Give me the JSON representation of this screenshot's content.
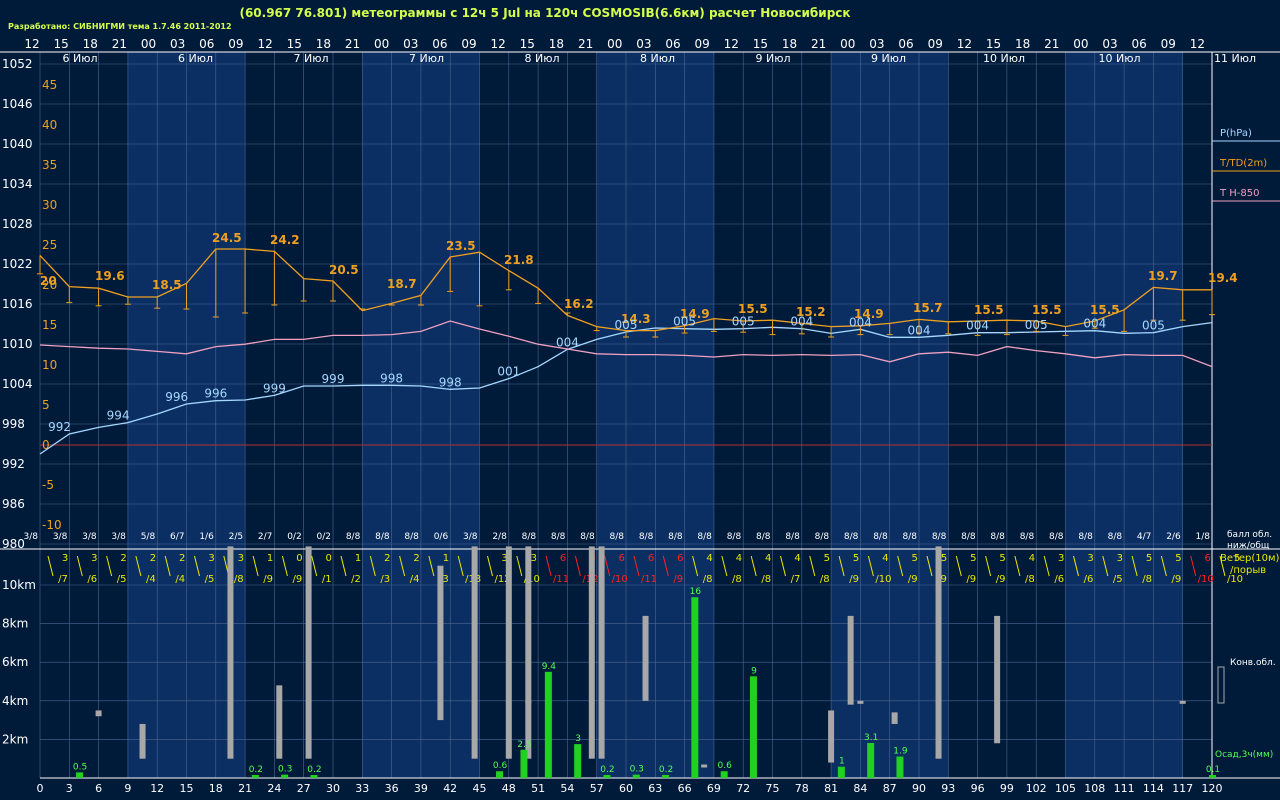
{
  "chart_data": {
    "type": "line",
    "title": "(60.967 76.801) метеограммы с  12ч 5 Jul на 120ч COSMOSIB(6.6км) расчет Новосибирск",
    "credit": "Разработано: СИБНИГМИ тема 1.7.46 2011-2012",
    "colors": {
      "bg": "#001a3a",
      "band": "#0b2f63",
      "grid": "#4d6690",
      "pressure": "#a6d8ff",
      "temp": "#f0a020",
      "t850": "#f0a0c0",
      "zero": "#b03030",
      "cloud": "#a8a8a8",
      "precip": "#22d022",
      "precip_label": "#50ff50",
      "wind": "#e8e800",
      "wind_red": "#ff2020",
      "text": "#ffffff"
    },
    "hours_top": [
      "12",
      "15",
      "18",
      "21",
      "00",
      "03",
      "06",
      "09",
      "12",
      "15",
      "18",
      "21",
      "00",
      "03",
      "06",
      "09",
      "12",
      "15",
      "18",
      "21",
      "00",
      "03",
      "06",
      "09",
      "12",
      "15",
      "18",
      "21",
      "00",
      "03",
      "06",
      "09",
      "12",
      "15",
      "18",
      "21",
      "00",
      "03",
      "06",
      "09",
      "12"
    ],
    "date_labels": [
      "6 Июл",
      "6 Июл",
      "7 Июл",
      "7 Июл",
      "8 Июл",
      "8 Июл",
      "9 Июл",
      "9 Июл",
      "10 Июл",
      "10 Июл",
      "11 Июл"
    ],
    "forecast_hours": [
      0,
      3,
      6,
      9,
      12,
      15,
      18,
      21,
      24,
      27,
      30,
      33,
      36,
      39,
      42,
      45,
      48,
      51,
      54,
      57,
      60,
      63,
      66,
      69,
      72,
      75,
      78,
      81,
      84,
      87,
      90,
      93,
      96,
      99,
      102,
      105,
      108,
      111,
      114,
      117,
      120
    ],
    "pressure_axis": {
      "labels": [
        "1052",
        "1046",
        "1040",
        "1034",
        "1028",
        "1022",
        "1016",
        "1010",
        "1004",
        "998",
        "992",
        "986",
        "980"
      ],
      "values": [
        1052,
        1046,
        1040,
        1034,
        1028,
        1022,
        1016,
        1010,
        1004,
        998,
        992,
        986,
        980
      ],
      "ylim": [
        980,
        1052
      ]
    },
    "temp_axis": {
      "labels": [
        "45",
        "40",
        "35",
        "30",
        "25",
        "20",
        "15",
        "10",
        "5",
        "0",
        "-5",
        "-10"
      ],
      "values": [
        45,
        40,
        35,
        30,
        25,
        20,
        15,
        10,
        5,
        0,
        -5,
        -10
      ]
    },
    "legend": [
      {
        "label": "P(hPa)",
        "color": "#a6d8ff"
      },
      {
        "label": "T/TD(2m)",
        "color": "#f0a020"
      },
      {
        "label": "T H-850",
        "color": "#f0a0c0"
      }
    ],
    "series": [
      {
        "name": "P(hPa)",
        "values": [
          993.5,
          996.5,
          997.5,
          998.2,
          999.5,
          1001,
          1001.5,
          1001.6,
          1002.3,
          1003.7,
          1003.7,
          1003.8,
          1003.8,
          1003.7,
          1003.2,
          1003.4,
          1004.8,
          1006.6,
          1009.2,
          1010.7,
          1011.8,
          1012.4,
          1012.3,
          1012.2,
          1012.3,
          1012.5,
          1012.3,
          1011.6,
          1012.2,
          1011,
          1011,
          1011.3,
          1011.7,
          1011.7,
          1011.8,
          1011.9,
          1012,
          1011.6,
          1011.7,
          1012.6,
          1013.2
        ]
      },
      {
        "name": "T/TD(2m)",
        "values": [
          23.7,
          19.8,
          19.6,
          18.5,
          18.5,
          20.2,
          24.5,
          24.5,
          24.2,
          20.8,
          20.5,
          16.8,
          17.7,
          18.7,
          23.5,
          24.1,
          21.8,
          19.6,
          16.2,
          14.8,
          14.3,
          14.3,
          14.9,
          15.8,
          15.5,
          15.6,
          15.2,
          14.8,
          14.9,
          15.2,
          15.7,
          15.4,
          15.5,
          15.6,
          15.5,
          14.8,
          15.5,
          16.9,
          19.7,
          19.4,
          19.4
        ]
      },
      {
        "name": "T H-850",
        "values": [
          12.5,
          12.3,
          12.1,
          12.0,
          11.7,
          11.4,
          12.3,
          12.6,
          13.2,
          13.2,
          13.7,
          13.7,
          13.8,
          14.2,
          15.5,
          14.5,
          13.6,
          12.6,
          12.0,
          11.4,
          11.3,
          11.3,
          11.2,
          11.0,
          11.3,
          11.2,
          11.3,
          11.2,
          11.3,
          10.4,
          11.4,
          11.6,
          11.2,
          12.3,
          11.8,
          11.4,
          10.9,
          11.3,
          11.2,
          11.2,
          9.8
        ]
      }
    ],
    "dew_ticks": [
      21.4,
      17.8,
      17.4,
      17.6,
      17.1,
      17.0,
      16.0,
      16.5,
      17.5,
      18.0,
      18.0,
      17.0,
      17.5,
      17.5,
      19.2,
      17.4,
      19.4,
      17.7,
      16.5,
      14.3,
      13.5,
      13.5,
      14.0,
      14.2,
      14.1,
      13.8,
      13.9,
      13.5,
      13.8,
      13.8,
      14.0,
      13.9,
      13.7,
      13.8,
      14.2,
      13.7,
      14.6,
      14.2,
      15.6,
      15.6,
      16.3
    ],
    "pressure_labels": [
      {
        "h": 3,
        "text": "992"
      },
      {
        "h": 12,
        "text": "994"
      },
      {
        "h": 21,
        "text": "996"
      },
      {
        "h": 27,
        "text": "996"
      },
      {
        "h": 36,
        "text": "999"
      },
      {
        "h": 45,
        "text": "999"
      },
      {
        "h": 54,
        "text": "998"
      },
      {
        "h": 63,
        "text": "998"
      },
      {
        "h": 72,
        "text": "001"
      },
      {
        "h": 81,
        "text": "004"
      },
      {
        "h": 90,
        "text": "005"
      },
      {
        "h": 99,
        "text": "005"
      },
      {
        "h": 108,
        "text": "005"
      },
      {
        "h": 117,
        "text": "004"
      },
      {
        "h": 126,
        "text": "004"
      },
      {
        "h": 135,
        "text": "004"
      },
      {
        "h": 144,
        "text": "004"
      },
      {
        "h": 153,
        "text": "005"
      },
      {
        "h": 162,
        "text": "004"
      },
      {
        "h": 171,
        "text": "005"
      }
    ],
    "temp_labels": [
      {
        "x": 40,
        "y": 285,
        "text": "20"
      },
      {
        "x": 95,
        "y": 280,
        "text": "19.6"
      },
      {
        "x": 152,
        "y": 289,
        "text": "18.5"
      },
      {
        "x": 212,
        "y": 242,
        "text": "24.5"
      },
      {
        "x": 270,
        "y": 244,
        "text": "24.2"
      },
      {
        "x": 329,
        "y": 274,
        "text": "20.5"
      },
      {
        "x": 387,
        "y": 288,
        "text": "18.7"
      },
      {
        "x": 446,
        "y": 250,
        "text": "23.5"
      },
      {
        "x": 504,
        "y": 264,
        "text": "21.8"
      },
      {
        "x": 564,
        "y": 308,
        "text": "16.2"
      },
      {
        "x": 621,
        "y": 323,
        "text": "14.3"
      },
      {
        "x": 680,
        "y": 318,
        "text": "14.9"
      },
      {
        "x": 738,
        "y": 313,
        "text": "15.5"
      },
      {
        "x": 796,
        "y": 316,
        "text": "15.2"
      },
      {
        "x": 854,
        "y": 318,
        "text": "14.9"
      },
      {
        "x": 913,
        "y": 312,
        "text": "15.7"
      },
      {
        "x": 974,
        "y": 314,
        "text": "15.5"
      },
      {
        "x": 1032,
        "y": 314,
        "text": "15.5"
      },
      {
        "x": 1090,
        "y": 314,
        "text": "15.5"
      },
      {
        "x": 1148,
        "y": 280,
        "text": "19.7"
      },
      {
        "x": 1208,
        "y": 282,
        "text": "19.4"
      }
    ],
    "cloud_fraction": [
      "3/8",
      "3/8",
      "3/8",
      "3/8",
      "5/8",
      "6/7",
      "1/6",
      "2/5",
      "2/7",
      "0/2",
      "0/2",
      "8/8",
      "8/8",
      "8/8",
      "0/6",
      "3/8",
      "2/8",
      "8/8",
      "8/8",
      "8/8",
      "8/8",
      "8/8",
      "8/8",
      "8/8",
      "8/8",
      "8/8",
      "8/8",
      "8/8",
      "8/8",
      "8/8",
      "8/8",
      "8/8",
      "8/8",
      "8/8",
      "8/8",
      "8/8",
      "8/8",
      "8/8",
      "4/7",
      "2/6",
      "1/8"
    ],
    "cloud_fraction_legend": "балл обл. ниж/общ",
    "wind_speed": [
      "",
      "3",
      "3",
      "2",
      "2",
      "2",
      "3",
      "3",
      "1",
      "0",
      "0",
      "1",
      "2",
      "2",
      "1",
      "2",
      "3",
      "3",
      "6",
      "6",
      "6",
      "6",
      "6",
      "4",
      "4",
      "4",
      "4",
      "5",
      "5",
      "4",
      "5",
      "5",
      "5",
      "5",
      "4",
      "3",
      "3",
      "3",
      "5",
      "5",
      "6",
      "5"
    ],
    "wind_gust": [
      "/7",
      "/6",
      "/5",
      "/4",
      "/4",
      "/5",
      "/8",
      "/9",
      "/9",
      "/1",
      "/2",
      "/3",
      "/4",
      "/3",
      "/13",
      "/12",
      "/10",
      "/11",
      "/12",
      "/10",
      "/11",
      "/9",
      "/8",
      "/8",
      "/8",
      "/7",
      "/8",
      "/9",
      "/10",
      "/9",
      "/9",
      "/9",
      "/9",
      "/8",
      "/6",
      "/6",
      "/5",
      "/8",
      "/9",
      "/10",
      "/10"
    ],
    "wind_legend": "Ветер(10м) /порыв",
    "cloud_axis": {
      "labels": [
        "10km",
        "8km",
        "6km",
        "4km",
        "2km"
      ],
      "values": [
        10,
        8,
        6,
        4,
        2
      ]
    },
    "cloud_legend": "Конв.обл.",
    "clouds": [
      [
        3.2,
        3.5
      ],
      [
        1,
        2.8
      ],
      [
        1,
        12
      ],
      [
        1,
        4.8
      ],
      [
        1,
        12
      ],
      [
        4,
        4
      ],
      [
        3,
        11
      ],
      [
        1,
        12
      ],
      [
        1,
        12
      ],
      [
        1,
        12
      ],
      [
        1,
        12
      ],
      [
        1,
        12
      ],
      [
        4,
        8.4
      ],
      [
        0.6,
        0.7
      ],
      [
        0.8,
        3.5
      ],
      [
        3.8,
        8.4
      ],
      [
        4,
        4
      ],
      [
        2.8,
        3.4
      ],
      [
        1,
        12
      ],
      [
        1.8,
        8.4
      ],
      [
        4,
        4
      ]
    ],
    "cloud_h": [
      6,
      10.5,
      19.5,
      24.5,
      27.5,
      50,
      41,
      44.5,
      48,
      50,
      56.5,
      57.5,
      62,
      68,
      81,
      83,
      84,
      87.5,
      92,
      98,
      117
    ],
    "precip_legend": "Осад,3ч(мм)",
    "precip": [
      {
        "h": 4,
        "v": 0.5,
        "label": "0.5"
      },
      {
        "h": 22,
        "v": 0.2,
        "label": "0.2"
      },
      {
        "h": 25,
        "v": 0.3,
        "label": "0.3"
      },
      {
        "h": 28,
        "v": 0.2,
        "label": "0.2"
      },
      {
        "h": 47,
        "v": 0.6,
        "label": "0.6"
      },
      {
        "h": 49.5,
        "v": 2.5,
        "label": "2.5"
      },
      {
        "h": 52,
        "v": 9.4,
        "label": "9.4"
      },
      {
        "h": 55,
        "v": 3,
        "label": "3"
      },
      {
        "h": 58,
        "v": 0.2,
        "label": "0.2"
      },
      {
        "h": 61,
        "v": 0.3,
        "label": "0.3"
      },
      {
        "h": 64,
        "v": 0.2,
        "label": "0.2"
      },
      {
        "h": 67,
        "v": 16,
        "label": "16"
      },
      {
        "h": 70,
        "v": 0.6,
        "label": "0.6"
      },
      {
        "h": 73,
        "v": 9,
        "label": "9"
      },
      {
        "h": 82,
        "v": 1,
        "label": "1"
      },
      {
        "h": 85,
        "v": 3.1,
        "label": "3.1"
      },
      {
        "h": 88,
        "v": 1.9,
        "label": "1.9"
      },
      {
        "h": 120,
        "v": 0.1,
        "label": "0.1"
      }
    ]
  }
}
